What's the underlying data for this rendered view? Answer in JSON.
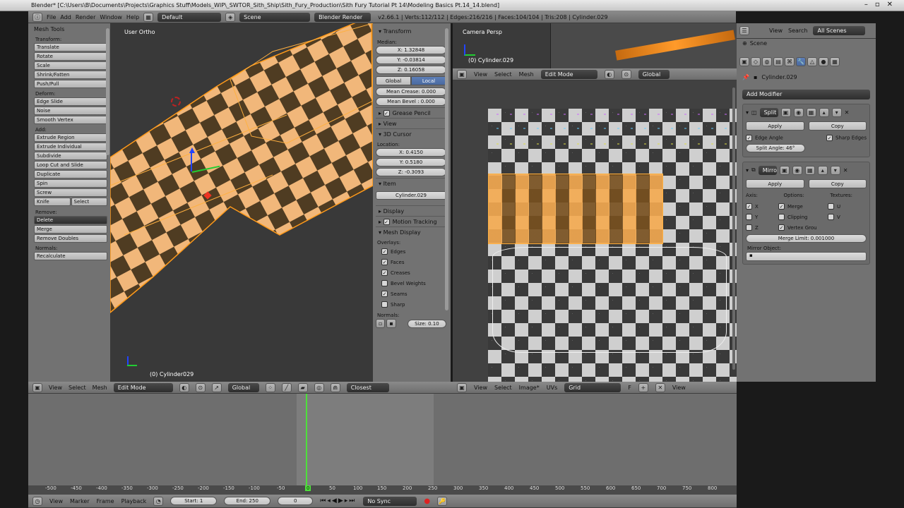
{
  "window": {
    "title": "Blender* [C:\\Users\\B\\Documents\\Projects\\Graphics Stuff\\Models_WIP\\_SWTOR_Sith_Ship\\Sith_Fury_Production\\Sith Fury Tutorial Pt 14\\Modeling Basics Pt.14_14.blend]"
  },
  "menubar": {
    "file": "File",
    "add": "Add",
    "render": "Render",
    "window": "Window",
    "help": "Help",
    "layout": "Default",
    "scene": "Scene",
    "engine": "Blender Render",
    "stats": "v2.66.1 | Verts:112/112 | Edges:216/216 | Faces:104/104 | Tris:208 | Cylinder.029"
  },
  "toolshelf": {
    "title": "Mesh Tools",
    "transform_label": "Transform:",
    "transform": [
      "Translate",
      "Rotate",
      "Scale",
      "Shrink/Fatten",
      "Push/Pull"
    ],
    "deform_label": "Deform:",
    "deform": [
      "Edge Slide",
      "Noise",
      "Smooth Vertex"
    ],
    "add_label": "Add:",
    "add": [
      "Extrude Region",
      "Extrude Individual",
      "Subdivide",
      "Loop Cut and Slide",
      "Duplicate",
      "Spin",
      "Screw"
    ],
    "knife": "Knife",
    "select": "Select",
    "remove_label": "Remove:",
    "delete": "Delete",
    "merge": "Merge",
    "remove_doubles": "Remove Doubles",
    "normals_label": "Normals:",
    "recalculate": "Recalculate"
  },
  "viewport": {
    "label": "User Ortho",
    "object": "(0) Cylinder029"
  },
  "npanel": {
    "transform": "Transform",
    "median": "Median:",
    "x": "X: 1.32848",
    "y": "Y: -0.03814",
    "z": "Z: 0.16058",
    "global": "Global",
    "local": "Local",
    "mean_crease": "Mean Crease: 0.000",
    "mean_bevel": "Mean Bevel : 0.000",
    "grease_pencil": "Grease Pencil",
    "view": "View",
    "cursor": "3D Cursor",
    "location": "Location:",
    "cx": "X: 0.4150",
    "cy": "Y: 0.5180",
    "cz": "Z: -0.3093",
    "item": "Item",
    "item_name": "Cylinder.029",
    "display": "Display",
    "motion_tracking": "Motion Tracking",
    "mesh_display": "Mesh Display",
    "overlays": "Overlays:",
    "edges": "Edges",
    "faces": "Faces",
    "creases": "Creases",
    "bevel_weights": "Bevel Weights",
    "seams": "Seams",
    "sharp": "Sharp",
    "normals": "Normals:",
    "size": "Size: 0.10"
  },
  "camera_view": {
    "label": "Camera Persp",
    "object": "(0) Cylinder.029",
    "view": "View",
    "select": "Select",
    "mesh": "Mesh",
    "mode": "Edit Mode",
    "orientation": "Global"
  },
  "properties": {
    "view": "View",
    "search": "Search",
    "scenes": "All Scenes",
    "scene": "Scene",
    "object": "Cylinder.029",
    "add_modifier": "Add Modifier",
    "split_name": "Split",
    "apply": "Apply",
    "copy": "Copy",
    "edge_angle": "Edge Angle",
    "sharp_edges": "Sharp Edges",
    "split_angle": "Split Angle: 46°",
    "mirror_name": "Mirror",
    "axis": "Axis:",
    "options": "Options:",
    "textures": "Textures:",
    "x": "X",
    "y": "Y",
    "z": "Z",
    "merge": "Merge",
    "clipping": "Clipping",
    "vertex_groups": "Vertex Grou",
    "u": "U",
    "v": "V",
    "merge_limit": "Merge Limit: 0.001000",
    "mirror_object": "Mirror Object:"
  },
  "viewport_header": {
    "view": "View",
    "select": "Select",
    "mesh": "Mesh",
    "mode": "Edit Mode",
    "orientation": "Global",
    "snap": "Closest"
  },
  "uv_header": {
    "view": "View",
    "select": "Select",
    "image": "Image*",
    "uvs": "UVs",
    "grid": "Grid",
    "f": "F",
    "view2": "View"
  },
  "timeline": {
    "ticks": [
      "-500",
      "-450",
      "-400",
      "-350",
      "-300",
      "-250",
      "-200",
      "-150",
      "-100",
      "-50",
      "0",
      "50",
      "100",
      "150",
      "200",
      "250",
      "300",
      "350",
      "400",
      "450",
      "500",
      "550",
      "600",
      "650",
      "700",
      "750",
      "800"
    ],
    "view": "View",
    "marker": "Marker",
    "frame": "Frame",
    "playback": "Playback",
    "start": "Start: 1",
    "end": "End: 250",
    "current": "0",
    "sync": "No Sync"
  }
}
